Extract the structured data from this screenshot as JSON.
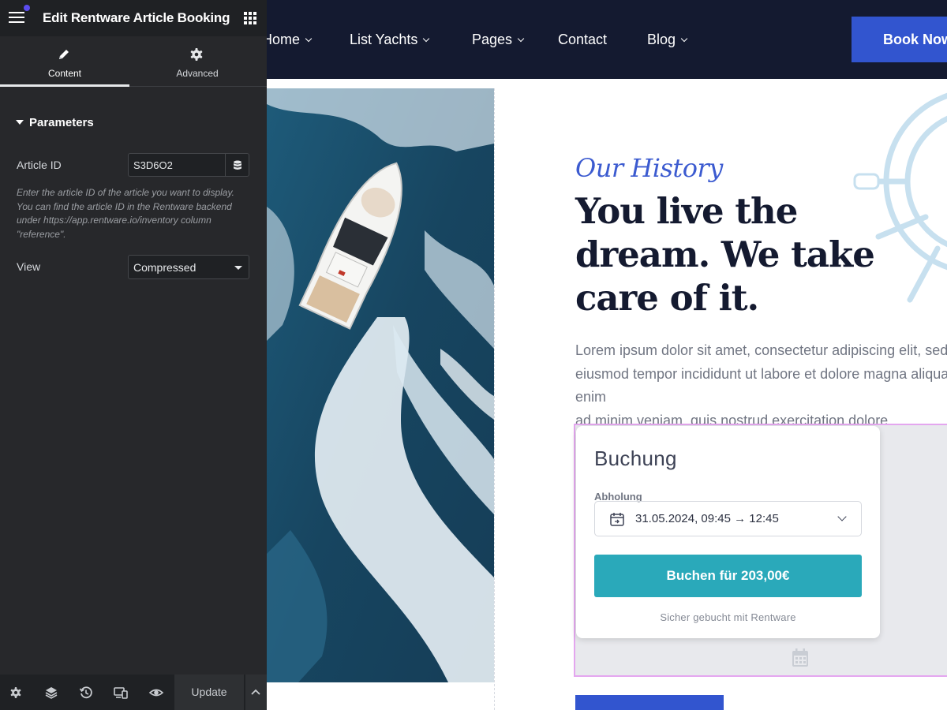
{
  "editor": {
    "title": "Edit Rentware Article Booking",
    "tabs": [
      {
        "label": "Content",
        "icon": "pencil-icon",
        "active": true
      },
      {
        "label": "Advanced",
        "icon": "gear-icon",
        "active": false
      }
    ],
    "section_title": "Parameters",
    "article_id": {
      "label": "Article ID",
      "value": "S3D6O2",
      "help": "Enter the article ID of the article you want to display. You can find the article ID in the Rentware backend under https://app.rentware.io/inventory column \"reference\"."
    },
    "view": {
      "label": "View",
      "selected": "Compressed"
    },
    "footer": {
      "icons": [
        "settings-icon",
        "layers-icon",
        "history-icon",
        "responsive-icon",
        "preview-eye-icon"
      ],
      "update_label": "Update"
    }
  },
  "site": {
    "nav": [
      "Home",
      "List Yachts",
      "Pages",
      "Contact",
      "Blog"
    ],
    "nav_dropdowns": [
      true,
      true,
      true,
      false,
      true
    ],
    "cta_label": "Book Now",
    "eyebrow": "Our History",
    "headline": "You live the dream. We take care of it.",
    "lead": "Lorem ipsum dolor sit amet, consectetur adipiscing elit, sed do\neiusmod tempor incididunt ut labore et dolore magna aliqua. Ut enim\nad minim veniam, quis nostrud exercitation dolore",
    "booking": {
      "title": "Buchung",
      "pickup_label": "Abholung",
      "date_value": "31.05.2024, 09:45 → 12:45",
      "button_label": "Buchen für 203,00€",
      "footer_text": "Sicher gebucht mit Rentware"
    }
  },
  "colors": {
    "panel_bg": "#27282b",
    "nav_bg": "#141a30",
    "brand_blue": "#3255cf",
    "booking_teal": "#2aa9ba",
    "selection_outline": "#e4a6ef"
  }
}
